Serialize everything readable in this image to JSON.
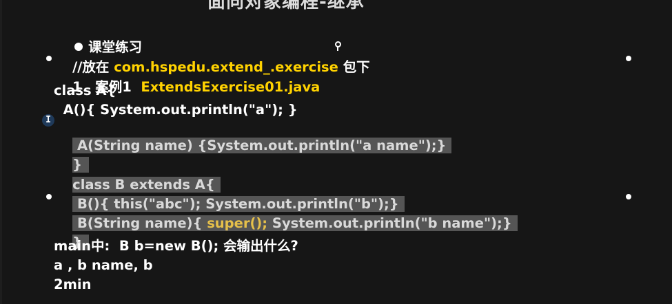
{
  "slide": {
    "title": "面向对象编程-继承",
    "heading": "课堂练习",
    "location_prefix": "//放在 ",
    "location_package": "com.hspedu.extend_.exercise",
    "location_suffix": " 包下",
    "case_prefix": "1．案例1  ",
    "case_file": "ExtendsExercise01.java",
    "code": {
      "l1": "class A{",
      "l2": "  A(){ System.out.println(\"a\"); }",
      "l3": " A(String name) {System.out.println(\"a name\");}",
      "l4": "}",
      "l5": "class B extends A{",
      "l6": " B(){ this(\"abc\"); System.out.println(\"b\");}",
      "l7a": " B(String name){ ",
      "l7b": "super();",
      "l7c": " System.out.println(\"b name\");}",
      "l8": "}"
    },
    "question": "main中:  B b=new B(); 会输出什么?",
    "answer": "a , b name, b",
    "time": "2min"
  },
  "cursor_glyph": "I",
  "colors": {
    "background": "#161616",
    "highlight": "#ffd200",
    "selection": "#555555"
  }
}
